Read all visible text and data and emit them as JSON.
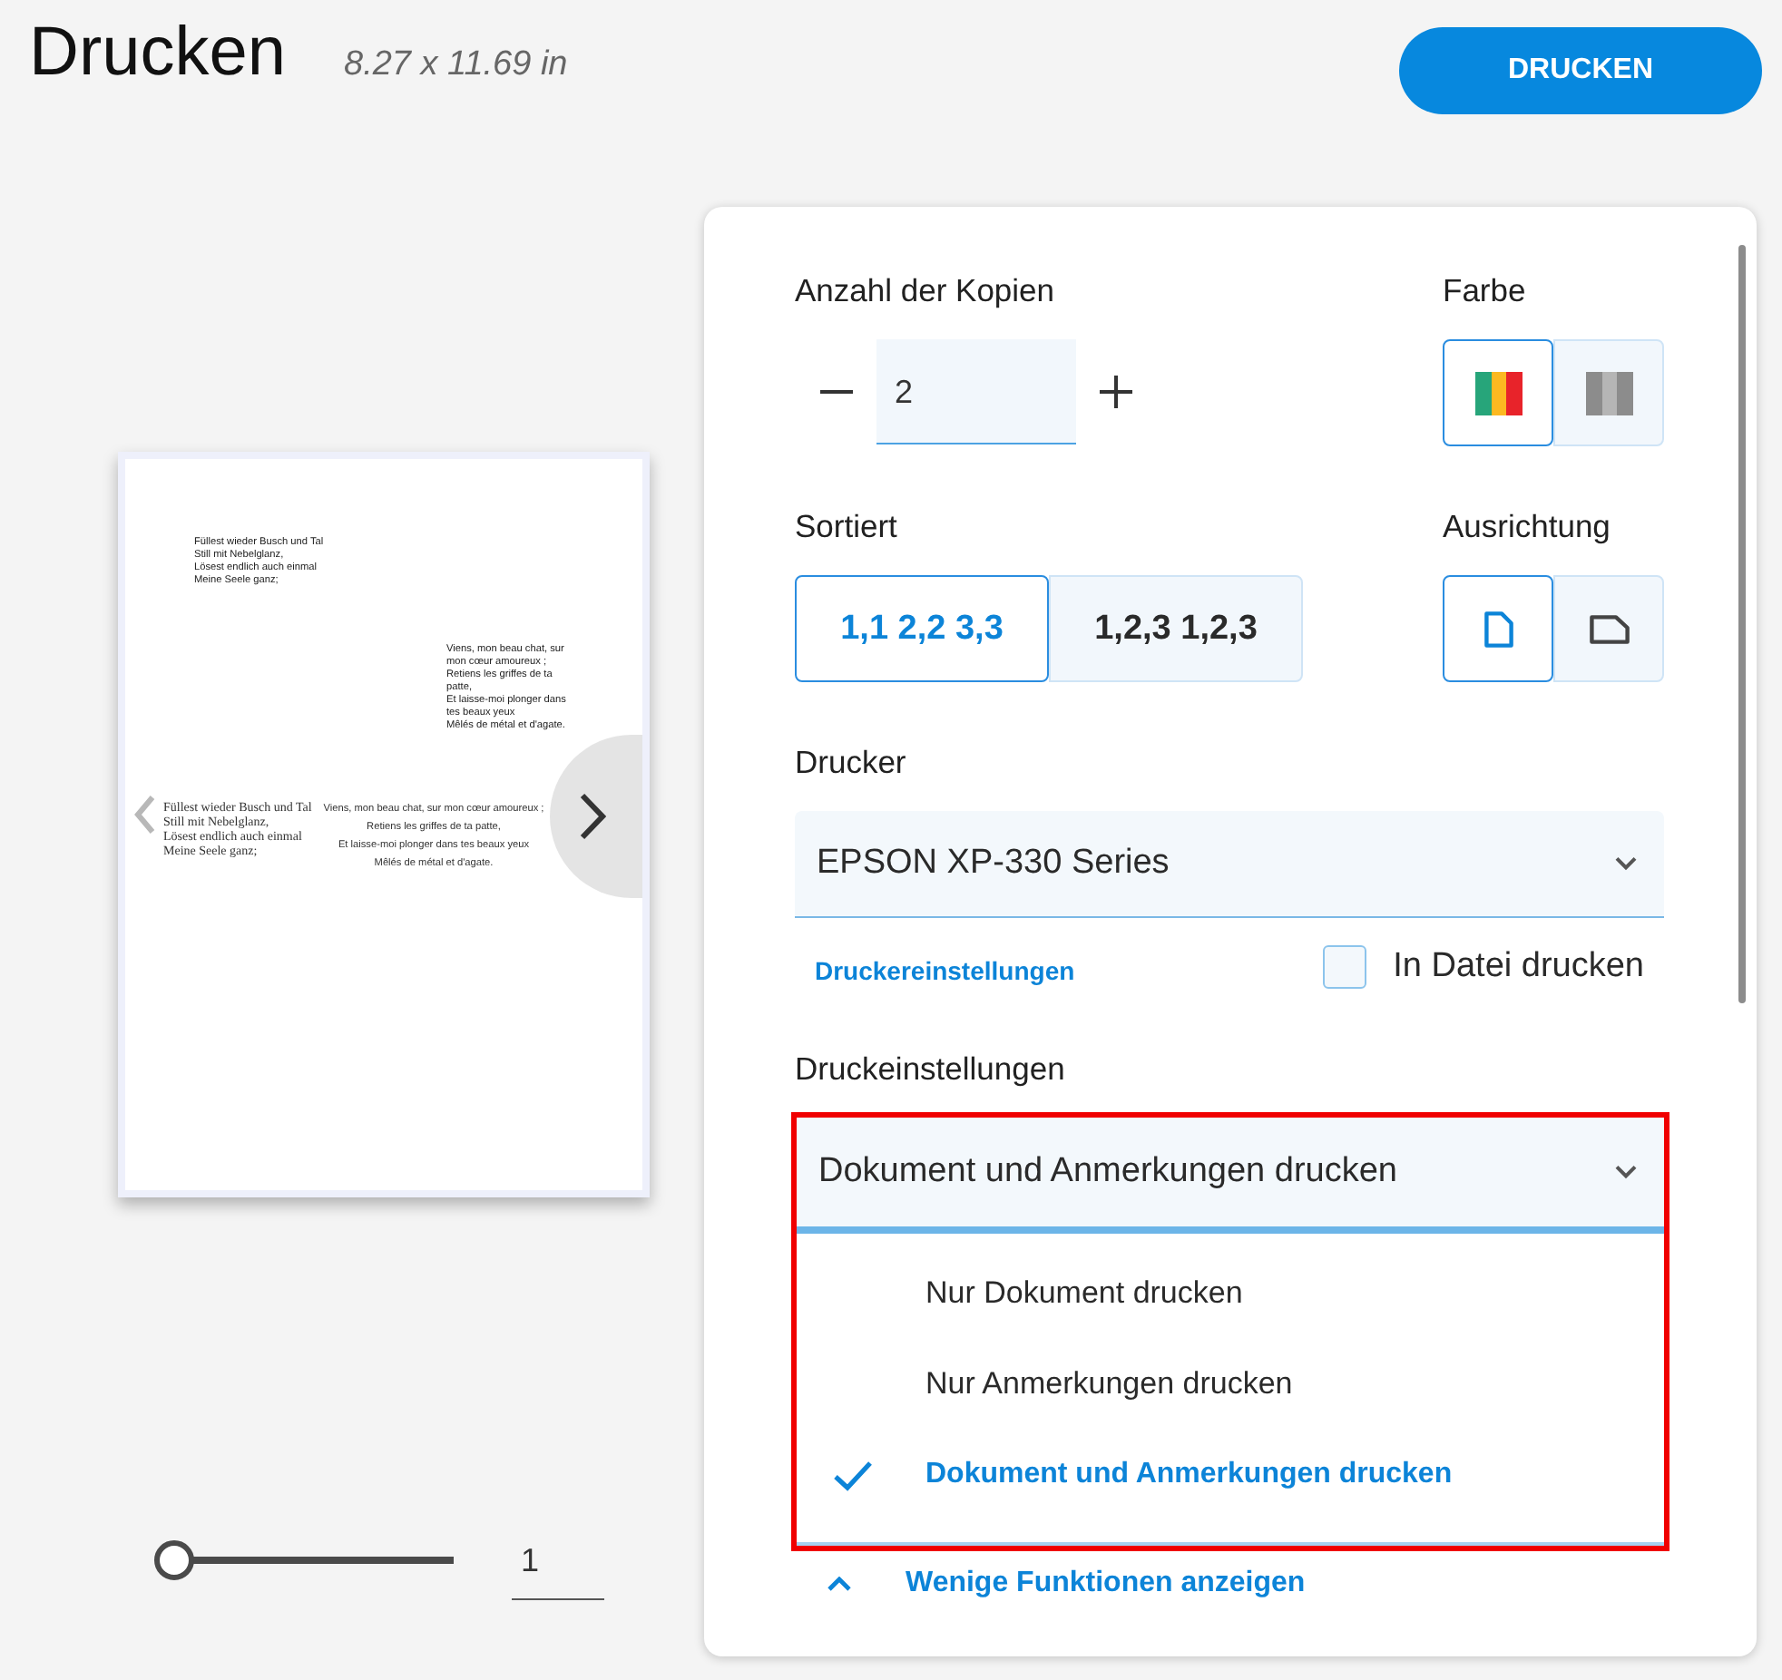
{
  "header": {
    "title": "Drucken",
    "page_size": "8.27 x 11.69 in",
    "print_button": "DRUCKEN"
  },
  "preview": {
    "page": {
      "rows": [
        {
          "blocks": [
            {
              "kind": "note",
              "lines": [
                "Füllest wieder Busch und Tal",
                "Still mit Nebelglanz,",
                "Lösest endlich auch einmal",
                "Meine Seele ganz;"
              ]
            }
          ]
        },
        {
          "blocks": [
            {
              "kind": "note",
              "lines": [
                "Viens, mon beau chat, sur",
                "mon cœur amoureux ;",
                "Retiens les griffes de ta",
                "patte,",
                "Et laisse-moi plonger dans",
                "tes beaux yeux",
                "Mêlés de métal et d'agate."
              ]
            }
          ]
        },
        {
          "blocks": [
            {
              "kind": "verse",
              "lines": [
                "Füllest wieder Busch und Tal",
                "Still mit Nebelglanz,",
                "Lösest endlich auch einmal",
                "Meine Seele ganz;"
              ]
            },
            {
              "kind": "centered",
              "lines": [
                "Viens, mon beau chat, sur mon cœur amoureux ;",
                "Retiens les griffes de ta patte,",
                "Et laisse-moi plonger dans tes beaux yeux",
                "Mêlés de métal et d'agate."
              ]
            }
          ]
        }
      ]
    },
    "navigation": [
      {
        "kind": "previous",
        "disabled": true
      },
      {
        "kind": "next",
        "disabled": false
      }
    ],
    "zoom_slider": {
      "level": 0
    },
    "page_number": "1"
  },
  "settings": {
    "copies": {
      "label": "Anzahl der Kopien",
      "value": "2"
    },
    "color": {
      "label": "Farbe",
      "options": [
        {
          "kind": "color",
          "selected": true
        },
        {
          "kind": "grayscale",
          "selected": false
        }
      ]
    },
    "collate": {
      "label": "Sortiert",
      "options": [
        {
          "label": "1,1 2,2 3,3",
          "selected": true
        },
        {
          "label": "1,2,3 1,2,3",
          "selected": false
        }
      ]
    },
    "orientation": {
      "label": "Ausrichtung",
      "options": [
        {
          "kind": "portrait",
          "selected": true
        },
        {
          "kind": "landscape",
          "selected": false
        }
      ]
    },
    "printer": {
      "label": "Drucker",
      "value": "EPSON XP-330 Series",
      "settings_link": "Druckereinstellungen",
      "print_to_file": {
        "label": "In Datei drucken",
        "checked": false
      }
    },
    "print_settings": {
      "label": "Druckeinstellungen",
      "value": "Dokument und Anmerkungen drucken",
      "expanded": true,
      "highlighted": true,
      "options": [
        {
          "label": "Nur Dokument drucken",
          "selected": false
        },
        {
          "label": "Nur Anmerkungen drucken",
          "selected": false
        },
        {
          "label": "Dokument und Anmerkungen drucken",
          "selected": true
        }
      ]
    },
    "more_options": {
      "label": "Wenige Funktionen anzeigen",
      "expanded": true
    }
  }
}
